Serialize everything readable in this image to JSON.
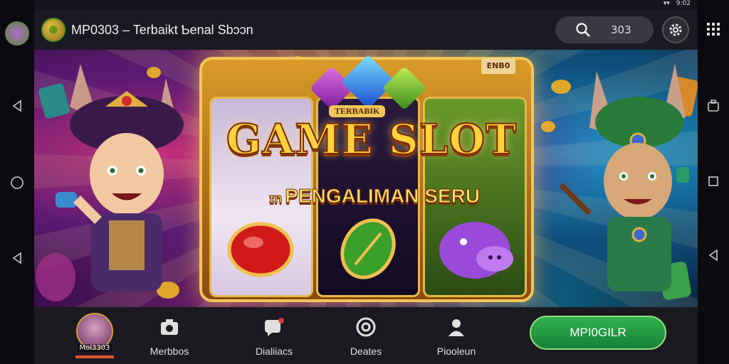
{
  "status": {
    "time": "9:02"
  },
  "header": {
    "title": "MP0303 – Terbaikt Ƅenal Sbɔɔn",
    "search_value": "303"
  },
  "banner": {
    "ribbon": "TERBAɃIK",
    "corner_tag": "ENB0",
    "headline": "GAME SLOT",
    "subheadline": "PENGALIMAN SERU",
    "sub_prefix": "ɪn"
  },
  "bottom_nav": {
    "avatar_label": "Mol3303",
    "items": [
      {
        "label": "Merbbos",
        "icon": "camera-icon"
      },
      {
        "label": "Dialiiacs",
        "icon": "chat-icon"
      },
      {
        "label": "Deates",
        "icon": "target-icon"
      },
      {
        "label": "Piooleun",
        "icon": "person-icon"
      }
    ],
    "cta_label": "MPI0GILR"
  },
  "colors": {
    "cta": "#1f9a44",
    "accent_gold": "#ffd23a",
    "topbar": "#1b1a22"
  }
}
